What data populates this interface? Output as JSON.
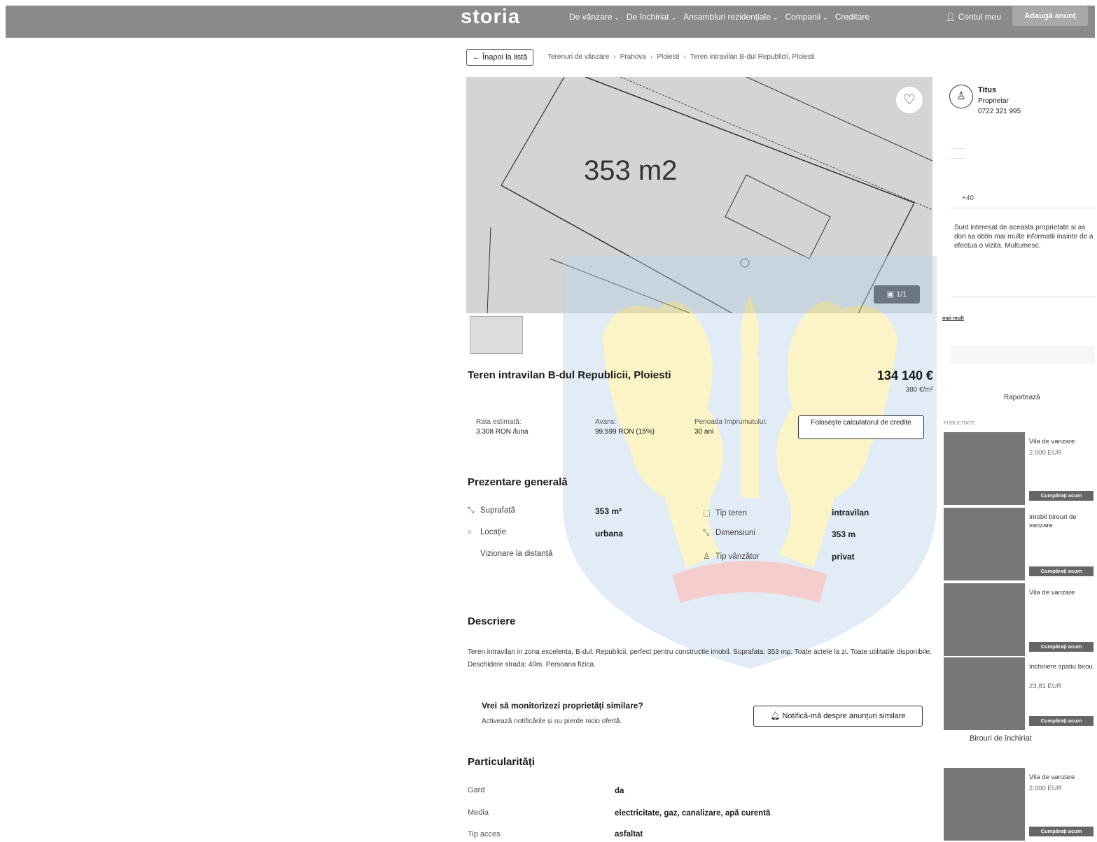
{
  "nav": {
    "logo": "storia",
    "items": [
      {
        "label": "De vânzare",
        "has_menu": true
      },
      {
        "label": "De închiriat",
        "has_menu": true
      },
      {
        "label": "Ansambluri rezidențiale",
        "has_menu": true
      },
      {
        "label": "Companii",
        "has_menu": true
      },
      {
        "label": "Creditare",
        "has_menu": false
      }
    ],
    "account_label": "Contul meu",
    "add_listing_label": "Adaugă anunț"
  },
  "breadcrumb": {
    "back_label": "Înapoi la listă",
    "items": [
      "Terenuri de vânzare",
      "Prahova",
      "Ploiesti",
      "Teren intravilan B-dul Republicii, Ploiesti"
    ]
  },
  "gallery": {
    "image_text": "353 m2",
    "photo_count": "1/1"
  },
  "listing": {
    "title": "Teren intravilan B-dul Republicii, Ploiesti",
    "price": "134 140 €",
    "price_per_m2": "380 €/m²"
  },
  "credit": {
    "rate_label": "Rata estimată:",
    "rate_value": "3.308 RON /luna",
    "advance_label": "Avans:",
    "advance_value": "99.599 RON (15%)",
    "period_label": "Perioada împrumutului:",
    "period_value": "30 ani",
    "calculator_label": "Folosește calculatorul de credite"
  },
  "overview": {
    "title": "Prezentare generală",
    "left": [
      {
        "icon": "area-icon",
        "label": "Suprafață",
        "value": "353 m²"
      },
      {
        "icon": "location-icon",
        "label": "Locație",
        "value": "urbana"
      },
      {
        "icon": "",
        "label": "Vizionare la distanță",
        "value": ""
      }
    ],
    "right": [
      {
        "icon": "land-type-icon",
        "label": "Tip teren",
        "value": "intravilan"
      },
      {
        "icon": "dimensions-icon",
        "label": "Dimensiuni",
        "value": "353 m"
      },
      {
        "icon": "seller-icon",
        "label": "Tip vânzător",
        "value": "privat"
      }
    ]
  },
  "description": {
    "title": "Descriere",
    "text": "Teren intravilan in zona excelenta, B-dul. Republicii, perfect pentru constructie imobil. Suprafata: 353 mp. Toate actele la zi. Toate utilitatile disponibile. Deschidere strada: 40m. Persoana fizica."
  },
  "monitor": {
    "title": "Vrei să monitorizezi proprietăți similare?",
    "subtitle": "Activează notificările și nu pierde nicio ofertă.",
    "button_label": "Notifică-mă despre anunțuri similare"
  },
  "features": {
    "title": "Particularități",
    "items": [
      {
        "label": "Gard",
        "value": "da"
      },
      {
        "label": "Media",
        "value": "electricitate, gaz, canalizare, apă curentă"
      },
      {
        "label": "Tip acces",
        "value": "asfaltat"
      }
    ]
  },
  "seller": {
    "name": "Titus",
    "type": "Proprietar",
    "phone": "0722 321 995"
  },
  "contact": {
    "phone_prefix": "+40",
    "message": "Sunt interesat de aceasta proprietate si as dori sa obtin mai multe informatii inainte de a efectua o vizita. Multumesc.",
    "consent_link": "mai mult",
    "report_label": "Raportează"
  },
  "ads": {
    "label": "PUBLICITATE",
    "cards": [
      {
        "title": "Vila de vanzare",
        "price": "2.000 EUR",
        "buy": "Cumpărați acum"
      },
      {
        "title": "Imobil birouri de vanzare",
        "price": "",
        "buy": "Cumpărați acum"
      },
      {
        "title": "Vila de vanzare",
        "price": "",
        "buy": "Cumpărați acum"
      },
      {
        "title": "Inchiriere spatiu birou",
        "price": "23,81 EUR",
        "buy": "Cumpărați acum"
      },
      {
        "title": "Vila de vanzare",
        "price": "2.000 EUR",
        "buy": "Cumpărați acum"
      }
    ],
    "sponsor_title": "Birouri de închiriat"
  },
  "colors": {
    "topbar": "#8a8a8a",
    "crest_shield": "#b9d4ec",
    "crest_lions": "#f5e77a",
    "crest_red": "#e98a8a"
  }
}
